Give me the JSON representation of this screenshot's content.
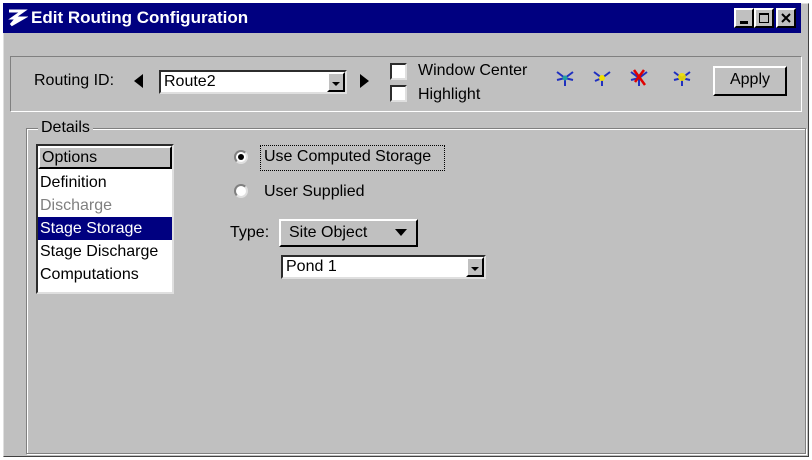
{
  "window": {
    "title": "Edit Routing Configuration",
    "controls": [
      "minimize-icon",
      "maximize-icon",
      "close-icon"
    ]
  },
  "toolbar": {
    "routing_id_label": "Routing ID:",
    "routing_id_value": "Route2",
    "window_center_label": "Window Center",
    "window_center_checked": false,
    "highlight_label": "Highlight",
    "highlight_checked": false,
    "tool_icons": [
      "network-blue-icon",
      "network-yellow-icon",
      "network-delete-icon",
      "network-highlight-icon"
    ],
    "apply_label": "Apply"
  },
  "details": {
    "group_label": "Details",
    "options_header": "Options",
    "options": [
      {
        "label": "Definition",
        "state": "normal"
      },
      {
        "label": "Discharge",
        "state": "disabled"
      },
      {
        "label": "Stage Storage",
        "state": "selected"
      },
      {
        "label": "Stage Discharge",
        "state": "normal"
      },
      {
        "label": "Computations",
        "state": "normal"
      }
    ],
    "radio_computed_label": "Use Computed Storage",
    "radio_computed_selected": true,
    "radio_user_label": "User Supplied",
    "radio_user_selected": false,
    "type_label": "Type:",
    "type_value": "Site Object",
    "object_value": "Pond 1"
  },
  "colors": {
    "titlebar": "#000080",
    "face": "#c0c0c0",
    "selection": "#000080"
  }
}
